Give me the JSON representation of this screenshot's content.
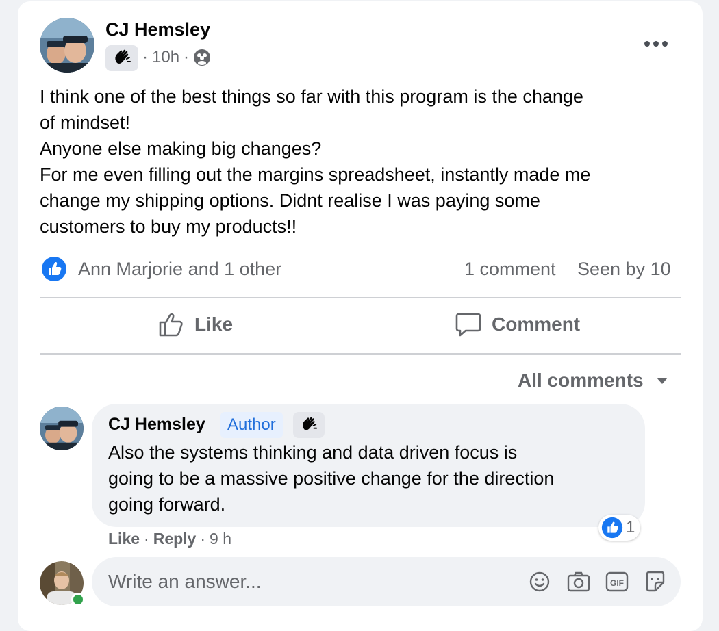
{
  "post": {
    "author": "CJ Hemsley",
    "time": "10h",
    "separator": "·",
    "more_label": "•••",
    "lines": [
      "I think one of the best things so far with this program is the change",
      "of mindset!",
      "Anyone else making big changes?",
      "For me even filling out the margins spreadsheet, instantly made me",
      "change my shipping options. Didnt realise I was paying some",
      "customers to buy my products!!"
    ],
    "reactions_text": "Ann Marjorie and 1 other",
    "comments_count": "1 comment",
    "seen_by": "Seen by 10"
  },
  "actions": {
    "like": "Like",
    "comment": "Comment"
  },
  "comments_filter": "All comments",
  "comment": {
    "author": "CJ Hemsley",
    "author_badge": "Author",
    "lines": [
      "Also the systems thinking and data driven focus is",
      "going to be a massive positive change for the direction",
      "going forward."
    ],
    "like_label": "Like",
    "reply_label": "Reply",
    "time": "9 h",
    "reaction_count": "1"
  },
  "composer": {
    "placeholder": "Write an answer..."
  },
  "colors": {
    "accent": "#1877f2",
    "online": "#31a24c"
  }
}
